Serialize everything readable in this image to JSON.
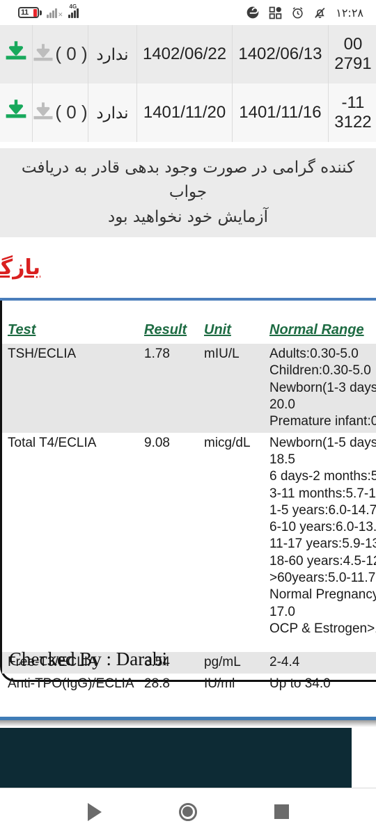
{
  "statusbar": {
    "battery_level": "11",
    "network_label": "4G",
    "time": "۱۲:۲۸",
    "icons": [
      "e-browser-icon",
      "qr-scan-icon",
      "alarm-icon",
      "mute-bell-icon"
    ]
  },
  "results_list": {
    "rows": [
      {
        "sample_id": "00\n2791",
        "id_line1": "00",
        "id_line2": "2791",
        "date_collected": "1402/06/13",
        "date_reported": "1402/06/22",
        "status": "ندارد",
        "attachment_count": "0",
        "download_label": "download-icon"
      },
      {
        "id_line1": "11-",
        "id_line2": "3122",
        "date_collected": "1401/11/16",
        "date_reported": "1401/11/20",
        "status": "ندارد",
        "attachment_count": "0",
        "download_label": "download-icon"
      }
    ]
  },
  "notice": {
    "line1": "کننده گرامی در صورت وجود بدهی قادر به دریافت جواب",
    "line2": "آزمایش خود نخواهید بود"
  },
  "back_link": {
    "label": "بازگشت",
    "color": "#d91f1f"
  },
  "report": {
    "headers": {
      "test": "Test",
      "result": "Result",
      "unit": "Unit",
      "range": "Normal Range"
    },
    "rows": [
      {
        "test": "TSH/ECLIA",
        "result": "1.78",
        "unit": "mIU/L",
        "range_lines": [
          "Adults:0.30-5.0",
          "Children:0.30-5.0",
          "Newborn(1-3 days",
          "20.0",
          "Premature infant:0"
        ]
      },
      {
        "test": "Total T4/ECLIA",
        "result": "9.08",
        "unit": "micg/dL",
        "range_lines": [
          "Newborn(1-5 days",
          "18.5",
          "6 days-2 months:5",
          "3-11 months:5.7-1",
          "1-5 years:6.0-14.7",
          "6-10 years:6.0-13.",
          "11-17 years:5.9-13",
          "18-60 years:4.5-12",
          ">60years:5.0-11.7",
          "Normal Pregnancy",
          "17.0",
          "OCP & Estrogen>1"
        ]
      },
      {
        "test": "Free-T3/ECLIA",
        "result": "3.54",
        "unit": "pg/mL",
        "range_lines": [
          "2-4.4"
        ]
      },
      {
        "test": "Anti-TPO(IgG)/ECLIA",
        "result": "28.8",
        "unit": "IU/ml",
        "range_lines": [
          "Up to 34.0"
        ]
      }
    ],
    "checked_by": "Checked By : Darabi"
  },
  "navbar": {
    "back": "back-button",
    "home": "home-button",
    "recents": "recents-button"
  },
  "colors": {
    "accent_blue": "#4a7ebb",
    "header_green": "#1d6b42",
    "link_red": "#d91f1f",
    "download_green": "#18a95c",
    "footer_dark": "#0d2b35"
  }
}
